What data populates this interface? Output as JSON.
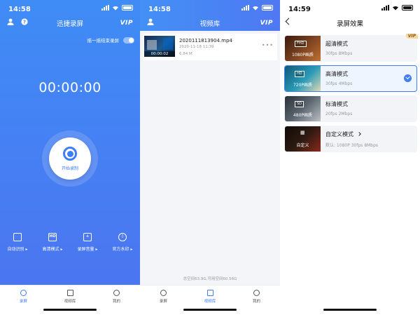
{
  "screens": {
    "record": {
      "time": "14:58",
      "title": "迅捷录屏",
      "vip": "VIP",
      "shake_toggle_label": "摇一摇结束录屏",
      "timer": "00:00:00",
      "record_button_label": "开始录制",
      "tools": [
        {
          "label": "自动识别 ▸",
          "icon": "rotate-icon",
          "glyph": ""
        },
        {
          "label": "高清模式 ▸",
          "icon": "hd-icon",
          "glyph": "HD"
        },
        {
          "label": "录屏音量 ▸",
          "icon": "volume-icon",
          "glyph": "+"
        },
        {
          "label": "官方水印 ▸",
          "icon": "watermark-icon",
          "glyph": "◊"
        }
      ],
      "tabs": [
        "录屏",
        "视频库",
        "我的"
      ],
      "active_tab": "录屏"
    },
    "library": {
      "time": "14:58",
      "title": "视频库",
      "vip": "VIP",
      "video": {
        "name": "2020111813904.mp4",
        "date": "2020-11-18 11:39",
        "size": "6.84 M",
        "duration": "00:00:02"
      },
      "storage": "总空间63.9G,可用空间60.56G",
      "tabs": [
        "录屏",
        "视频库",
        "我的"
      ],
      "active_tab": "视频库"
    },
    "quality": {
      "time": "14:59",
      "title": "录屏效果",
      "modes": [
        {
          "title": "超清模式",
          "sub": "30fps 8Mbps",
          "res": "1080P画质",
          "badge": "FHD",
          "vip": "VIP",
          "selected": false,
          "thumb_color": "#7a4220"
        },
        {
          "title": "高清模式",
          "sub": "30fps 4Mbps",
          "res": "720P画质",
          "badge": "HD",
          "selected": true,
          "thumb_color": "#2a9bb8"
        },
        {
          "title": "标清模式",
          "sub": "20fps 2Mbps",
          "res": "480P画质",
          "badge": "SD",
          "selected": false,
          "thumb_color": "#5c6670"
        },
        {
          "title": "自定义模式",
          "sub": "默认: 1080P 30fps 8Mbps",
          "res": "自定义",
          "badge": "",
          "selected": false,
          "thumb_color": "#2c1a12"
        }
      ]
    }
  },
  "colors": {
    "accent": "#3f7ef5",
    "gradient_top": "#3f8cf6",
    "gradient_bottom": "#4d73f0"
  }
}
